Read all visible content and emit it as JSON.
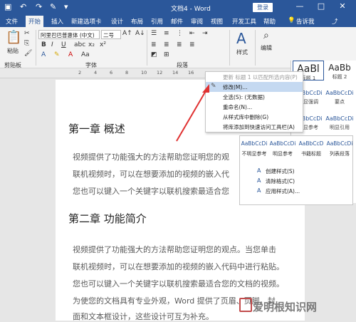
{
  "window": {
    "title": "文档4 - Word",
    "login_label": "登录",
    "min": "—",
    "max": "□",
    "close": "✕"
  },
  "tabs": [
    {
      "label": "文件"
    },
    {
      "label": "开始"
    },
    {
      "label": "插入"
    },
    {
      "label": "新建选项卡"
    },
    {
      "label": "设计"
    },
    {
      "label": "布局"
    },
    {
      "label": "引用"
    },
    {
      "label": "邮件"
    },
    {
      "label": "审阅"
    },
    {
      "label": "视图"
    },
    {
      "label": "开发工具"
    },
    {
      "label": "帮助"
    },
    {
      "label": "告诉我"
    }
  ],
  "ribbon": {
    "paste_label": "粘贴",
    "clipboard_label": "剪贴板",
    "font_name": "阿里巴巴普惠体 (中文)",
    "font_size": "二号",
    "font_group_label": "字体",
    "paragraph_group_label": "段落",
    "styles_label": "样式",
    "editing_label": "编辑"
  },
  "ruler": {
    "ticks": [
      "2",
      "4",
      "6",
      "8",
      "10",
      "12",
      "14",
      "16"
    ]
  },
  "document": {
    "heading1": "第一章 概述",
    "para1": [
      "视频提供了功能强大的方法帮助您证明您的观",
      "联机视频时，可以在想要添加的视频的嵌入代",
      "您也可以键入一个关键字以联机搜索最适合您"
    ],
    "heading2": "第二章 功能简介",
    "para2": [
      "视频提供了功能强大的方法帮助您证明您的观点。当您单击",
      "联机视频时，可以在想要添加的视频的嵌入代码中进行粘贴。",
      "您也可以键入一个关键字以联机搜索最适合您的文档的视频。",
      "为使您的文档具有专业外观，Word 提供了页眉、页脚、封",
      "面和文本框设计，这些设计可互为补充。"
    ]
  },
  "style_gallery": {
    "cards": [
      {
        "preview": "AaBl",
        "name": "标题 1"
      },
      {
        "preview": "AaBb",
        "name": "标题 2"
      },
      {
        "preview": "AaBbCcDi",
        "name": "明显强调"
      },
      {
        "preview": "AaBbCcDi",
        "name": "要点"
      },
      {
        "preview": "AaBbCcDi",
        "name": "明显参考"
      },
      {
        "preview": "AaBbCcDi",
        "name": "明显引用"
      }
    ]
  },
  "context_menu": {
    "items": [
      {
        "label": "更新 标题 1 以匹配所选内容(P)",
        "dim": true
      },
      {
        "label": "修改(M)...",
        "highlight": true
      },
      {
        "label": "全选(S): (无数据)"
      },
      {
        "label": "重命名(N)..."
      },
      {
        "label": "从样式库中删除(G)"
      },
      {
        "label": "将库添加到快速访问工具栏(A)"
      }
    ]
  },
  "submenu": {
    "cards": [
      {
        "preview": "AaBbCcDi",
        "name": "不明显参考"
      },
      {
        "preview": "AaBbCcDi",
        "name": "明显参考"
      },
      {
        "preview": "AaBbCcD",
        "name": "书籍标题"
      },
      {
        "preview": "AaBbCcDi",
        "name": "列表段落"
      }
    ],
    "actions": [
      {
        "label": "创建样式(S)"
      },
      {
        "label": "清除格式(C)"
      },
      {
        "label": "应用样式(A)..."
      }
    ]
  },
  "watermark": {
    "text": "爱明根知识网"
  },
  "colors": {
    "accent": "#2b579a",
    "arrow": "#e03232",
    "highlight": "#c5d9f1"
  }
}
